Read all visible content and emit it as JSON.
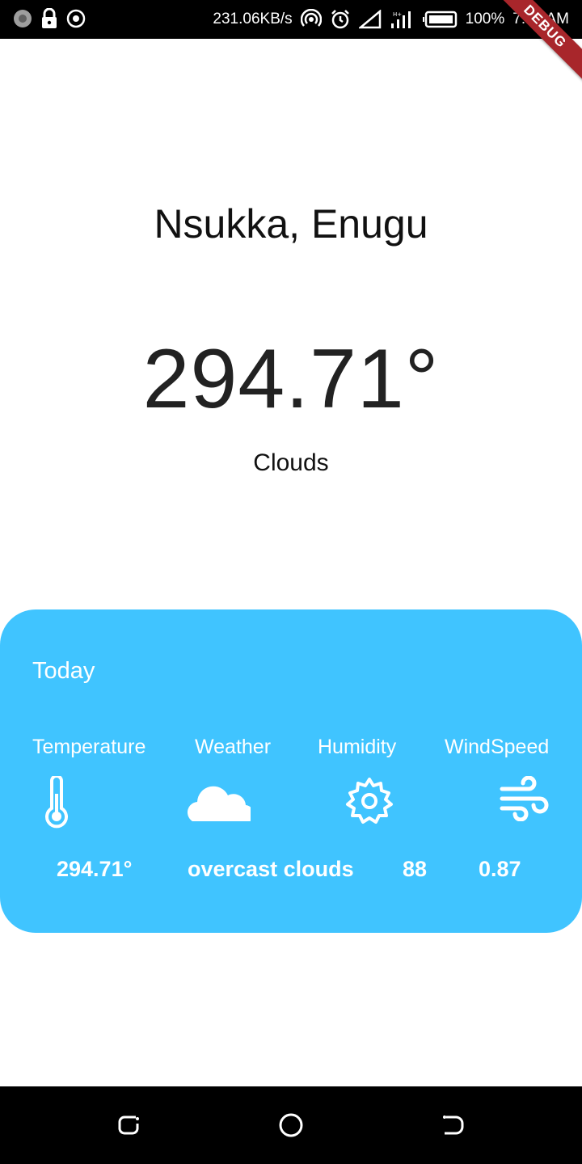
{
  "status_bar": {
    "left_icons": [
      "pinwheel-icon",
      "lock-icon",
      "target-icon"
    ],
    "speed": "231.06KB/s",
    "battery": "100%",
    "time": "7:39 AM"
  },
  "debug_banner": "DEBUG",
  "location": "Nsukka, Enugu",
  "current": {
    "temperature": "294.71°",
    "condition": "Clouds"
  },
  "today_card": {
    "title": "Today",
    "background": "#40c4ff",
    "items": [
      {
        "label": "Temperature",
        "icon": "thermometer-icon",
        "value": "294.71°"
      },
      {
        "label": "Weather",
        "icon": "cloud-icon",
        "value": "overcast clouds"
      },
      {
        "label": "Humidity",
        "icon": "gear-icon",
        "value": "88"
      },
      {
        "label": "WindSpeed",
        "icon": "wind-icon",
        "value": "0.87"
      }
    ]
  },
  "nav_bar": {
    "buttons": [
      "recent-apps-icon",
      "home-icon",
      "back-icon"
    ]
  }
}
